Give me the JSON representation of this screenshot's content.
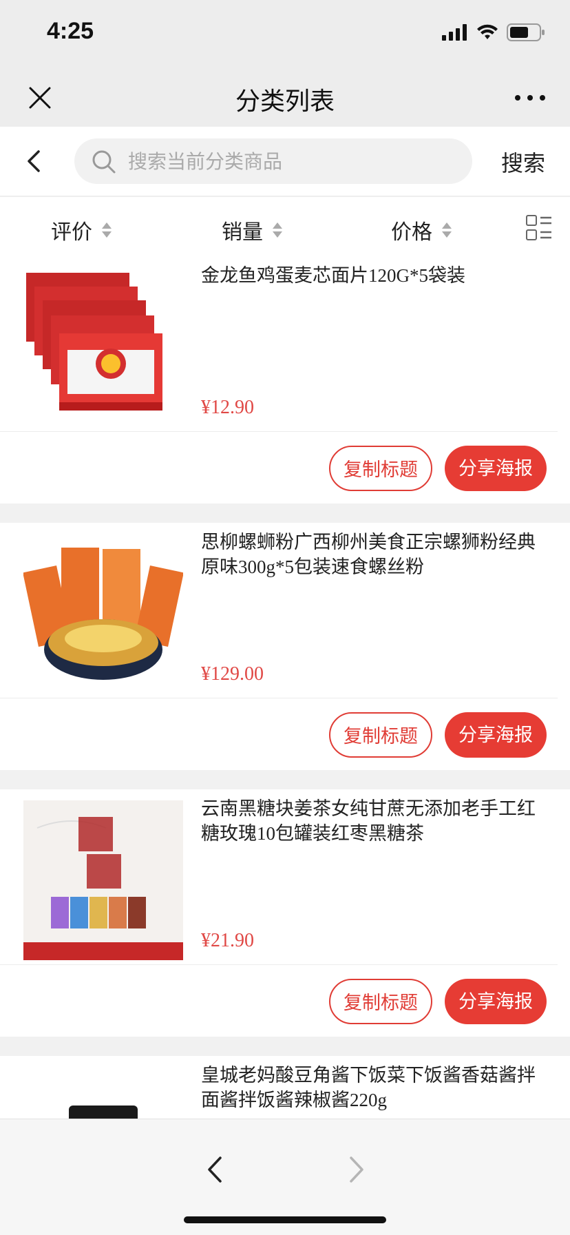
{
  "status": {
    "time": "4:25"
  },
  "nav": {
    "title": "分类列表"
  },
  "search": {
    "placeholder": "搜索当前分类商品",
    "value": "",
    "button_label": "搜索"
  },
  "sort": {
    "items": [
      {
        "label": "评价"
      },
      {
        "label": "销量"
      },
      {
        "label": "价格"
      }
    ]
  },
  "products": [
    {
      "title": "金龙鱼鸡蛋麦芯面片120G*5袋装",
      "price": "¥12.90",
      "copy_label": "复制标题",
      "share_label": "分享海报"
    },
    {
      "title": "思柳螺蛳粉广西柳州美食正宗螺狮粉经典原味300g*5包装速食螺丝粉",
      "price": "¥129.00",
      "copy_label": "复制标题",
      "share_label": "分享海报"
    },
    {
      "title": "云南黑糖块姜茶女纯甘蔗无添加老手工红糖玫瑰10包罐装红枣黑糖茶",
      "price": "¥21.90",
      "copy_label": "复制标题",
      "share_label": "分享海报"
    },
    {
      "title": "皇城老妈酸豆角酱下饭菜下饭酱香菇酱拌面酱拌饭酱辣椒酱220g"
    }
  ],
  "colors": {
    "accent": "#e63c34",
    "price": "#e04845"
  }
}
